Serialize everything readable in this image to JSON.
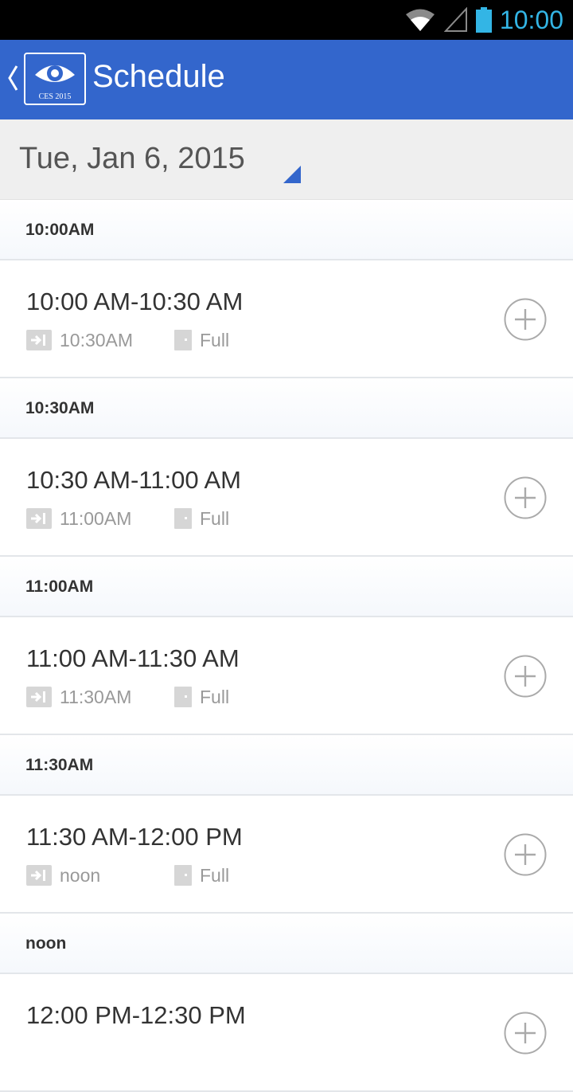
{
  "status_bar": {
    "time": "10:00",
    "icons": [
      "wifi-icon",
      "signal-icon",
      "battery-icon"
    ]
  },
  "app_bar": {
    "title": "Schedule",
    "logo_text": "CES 2015",
    "accent_color": "#3366cc"
  },
  "date_selector": {
    "value": "Tue, Jan 6, 2015"
  },
  "schedule": [
    {
      "header": "10:00AM",
      "time_range": "10:00 AM-10:30 AM",
      "ends": "10:30AM",
      "capacity": "Full"
    },
    {
      "header": "10:30AM",
      "time_range": "10:30 AM-11:00 AM",
      "ends": "11:00AM",
      "capacity": "Full"
    },
    {
      "header": "11:00AM",
      "time_range": "11:00 AM-11:30 AM",
      "ends": "11:30AM",
      "capacity": "Full"
    },
    {
      "header": "11:30AM",
      "time_range": "11:30 AM-12:00 PM",
      "ends": "noon",
      "capacity": "Full"
    },
    {
      "header": "noon",
      "time_range": "12:00 PM-12:30 PM",
      "ends": "",
      "capacity": ""
    }
  ]
}
